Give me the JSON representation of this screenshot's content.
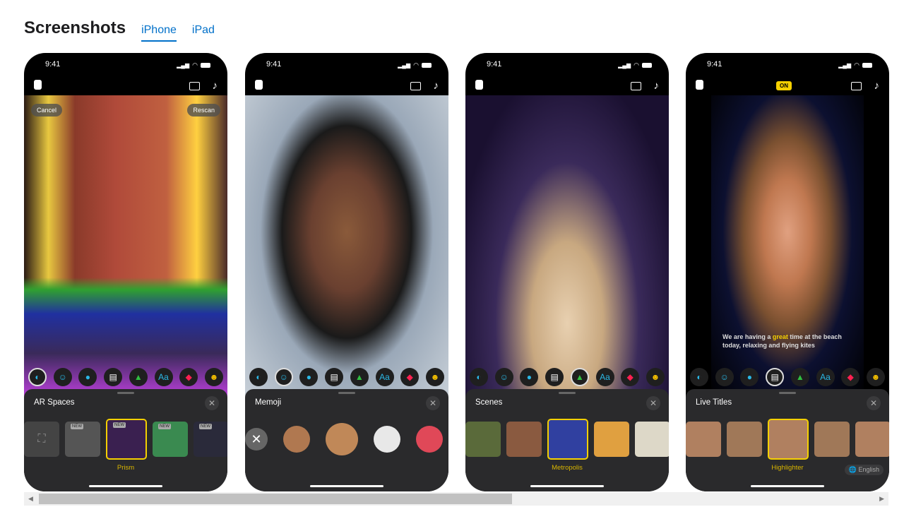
{
  "header": {
    "title": "Screenshots",
    "tabs": [
      {
        "label": "iPhone",
        "active": true
      },
      {
        "label": "iPad",
        "active": false
      }
    ]
  },
  "screenshots": [
    {
      "time": "9:41",
      "overlay_buttons": [
        "Cancel",
        "Rescan"
      ],
      "panel_title": "AR Spaces",
      "selected_tool": 0,
      "thumb_label": "Prism",
      "badges": [
        "NEW",
        "NEW",
        "NEW",
        "NEW"
      ]
    },
    {
      "time": "9:41",
      "panel_title": "Memoji",
      "selected_tool": 1
    },
    {
      "time": "9:41",
      "panel_title": "Scenes",
      "selected_tool": 4,
      "thumb_label": "Metropolis"
    },
    {
      "time": "9:41",
      "badge": "ON",
      "caption_pre": "We are having a ",
      "caption_highlight": "great",
      "caption_post": " time at the beach today, relaxing and flying kites",
      "panel_title": "Live Titles",
      "selected_tool": 3,
      "thumb_label": "Highlighter",
      "language": "English"
    }
  ],
  "toolbar_text_tool": "Aa",
  "accent_color": "#0070c9",
  "highlight_color": "#f5d000"
}
